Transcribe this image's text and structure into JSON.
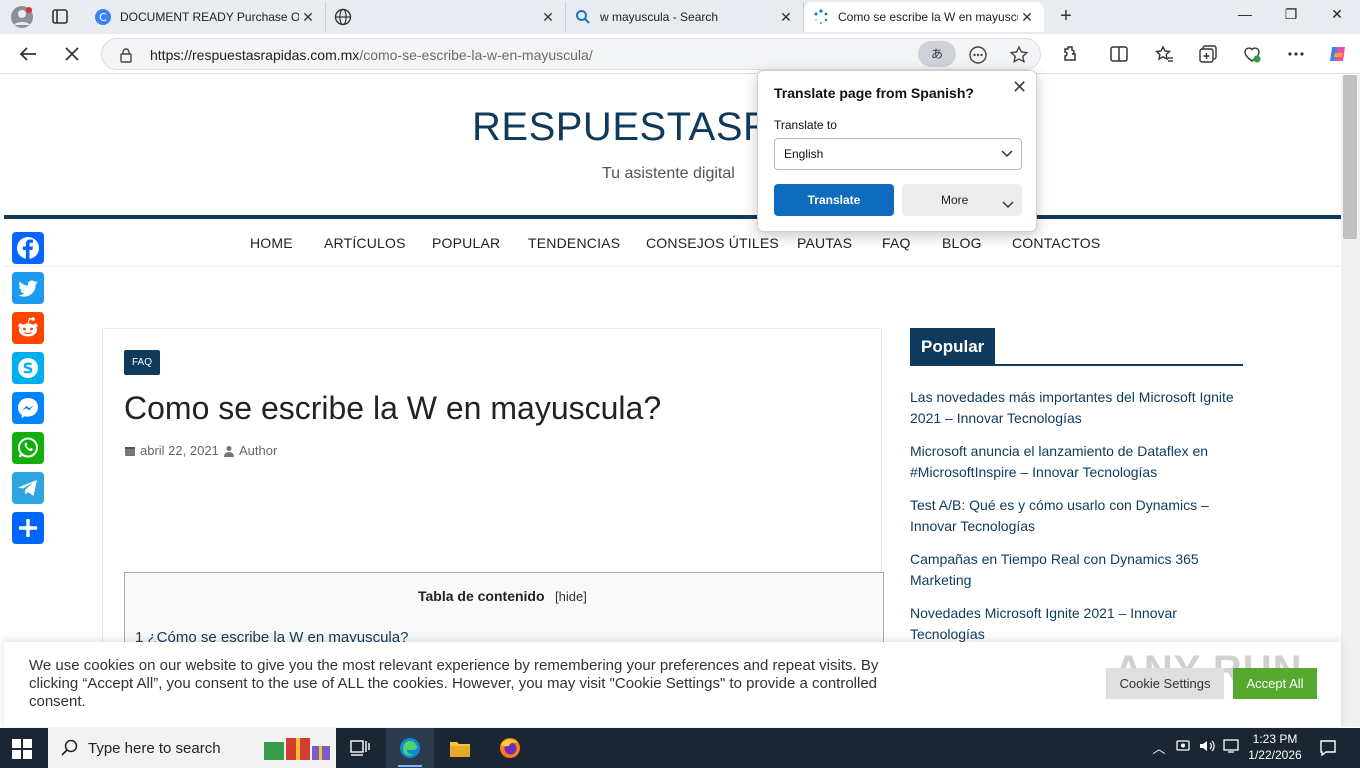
{
  "browser": {
    "tabs": [
      {
        "title": "DOCUMENT READY Purchase Orde",
        "icon": "copilot-c-icon"
      },
      {
        "title": "",
        "icon": "globe-icon"
      },
      {
        "title": "w mayuscula - Search",
        "icon": "search-icon"
      },
      {
        "title": "Como se escribe la W en mayuscu",
        "icon": "loading-spinner-icon"
      }
    ],
    "url_host": "https://respuestasrapidas.com.mx",
    "url_path": "/como-se-escribe-la-w-en-mayuscula/",
    "translate_button": "あ"
  },
  "translate_popup": {
    "title": "Translate page from Spanish?",
    "label": "Translate to",
    "language": "English",
    "translate_button": "Translate",
    "more_button": "More"
  },
  "site": {
    "title": "RESPUESTASRA",
    "tagline": "Tu asistente digital",
    "menu": [
      "HOME",
      "ARTÍCULOS",
      "POPULAR",
      "TENDENCIAS",
      "CONSEJOS ÚTILES",
      "PAUTAS",
      "FAQ",
      "BLOG",
      "CONTACTOS"
    ],
    "share_buttons": [
      "facebook",
      "twitter",
      "reddit",
      "skype",
      "messenger",
      "whatsapp",
      "telegram",
      "share"
    ]
  },
  "article": {
    "category": "FAQ",
    "title": "Como se escribe la W en mayuscula?",
    "date": "abril 22, 2021",
    "author": "Author",
    "toc_title": "Tabla de contenido",
    "toc_hide": "[hide]",
    "toc_first_item": "1 ¿Cómo se escribe la W en mayuscula?"
  },
  "sidebar": {
    "title": "Popular",
    "items": [
      "Las novedades más importantes del Microsoft Ignite 2021 – Innovar Tecnologías",
      "Microsoft anuncia el lanzamiento de Dataflex en #MicrosoftInspire – Innovar Tecnologías",
      "Test A/B: Qué es y cómo usarlo con Dynamics – Innovar Tecnologías",
      "Campañas en Tiempo Real con Dynamics 365 Marketing",
      "Novedades Microsoft Ignite 2021 – Innovar Tecnologías"
    ]
  },
  "cookie": {
    "text": "We use cookies on our website to give you the most relevant experience by remembering your preferences and repeat visits. By clicking “Accept All”, you consent to the use of ALL the cookies. However, you may visit \"Cookie Settings\" to provide a controlled consent.",
    "settings_button": "Cookie Settings",
    "accept_button": "Accept All",
    "watermark": "ANY RUN"
  },
  "taskbar": {
    "search_placeholder": "Type here to search",
    "time": "1:23 PM",
    "date": "1/22/2026"
  },
  "colors": {
    "brand_navy": "#103a5c",
    "accept_green": "#55a92e",
    "translate_blue": "#0f6cbd"
  }
}
